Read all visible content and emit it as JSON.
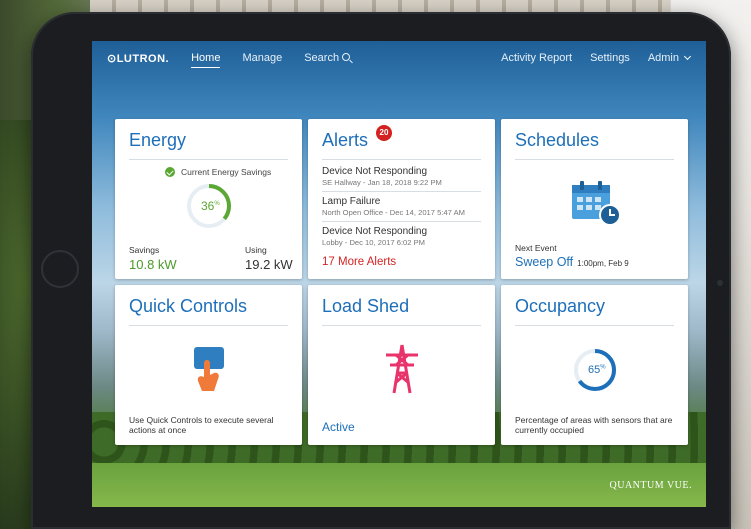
{
  "nav": {
    "logo": "⊙LUTRON.",
    "home": "Home",
    "manage": "Manage",
    "search": "Search",
    "activity_report": "Activity Report",
    "settings": "Settings",
    "admin": "Admin"
  },
  "energy": {
    "title": "Energy",
    "savings_label": "Current Energy Savings",
    "percent": "36",
    "percent_unit": "%",
    "percent_value": 0.36,
    "savings_caption": "Savings",
    "savings_value": "10.8 kW",
    "using_caption": "Using",
    "using_value": "19.2 kW"
  },
  "alerts": {
    "title": "Alerts",
    "badge": "20",
    "items": [
      {
        "title": "Device Not Responding",
        "sub": "SE Hallway - Jan 18, 2018 9:22 PM"
      },
      {
        "title": "Lamp Failure",
        "sub": "North Open Office - Dec 14, 2017 5:47 AM"
      },
      {
        "title": "Device Not Responding",
        "sub": "Lobby - Dec 10, 2017 6:02 PM"
      }
    ],
    "more": "17 More Alerts"
  },
  "schedules": {
    "title": "Schedules",
    "next_label": "Next Event",
    "next_event": "Sweep Off",
    "next_time": "1:00pm, Feb 9"
  },
  "quick_controls": {
    "title": "Quick Controls",
    "desc": "Use Quick Controls to execute several actions at once"
  },
  "load_shed": {
    "title": "Load Shed",
    "status": "Active"
  },
  "occupancy": {
    "title": "Occupancy",
    "percent": "65",
    "percent_unit": "%",
    "percent_value": 0.65,
    "desc": "Percentage of areas with sensors that are currently occupied"
  },
  "footer": {
    "brand": "QUANTUM VUE."
  },
  "colors": {
    "accent": "#1e6fb9",
    "green": "#5aa733",
    "alert_red": "#d32222"
  }
}
